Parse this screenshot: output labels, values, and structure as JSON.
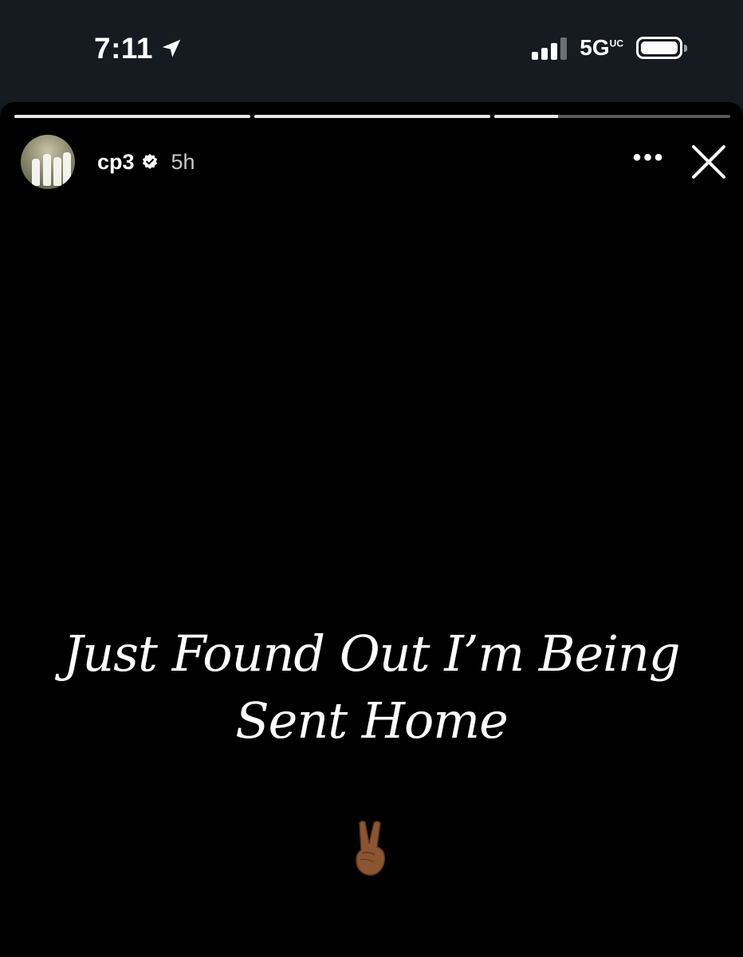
{
  "status_bar": {
    "time": "7:11",
    "location_icon": "location-arrow-icon",
    "signal_icon": "cellular-signal-icon",
    "network": "5G",
    "network_suffix": "UC",
    "battery_icon": "battery-full-icon"
  },
  "story": {
    "progress_segments": [
      1.0,
      1.0,
      0.27
    ],
    "user": {
      "username": "cp3",
      "verified": true,
      "posted_ago": "5h"
    },
    "more_icon": "more-horizontal-icon",
    "close_icon": "close-icon",
    "text_line1": "Just Found Out I’m Being",
    "text_line2": "Sent Home",
    "emoji": "victory-hand-icon"
  }
}
